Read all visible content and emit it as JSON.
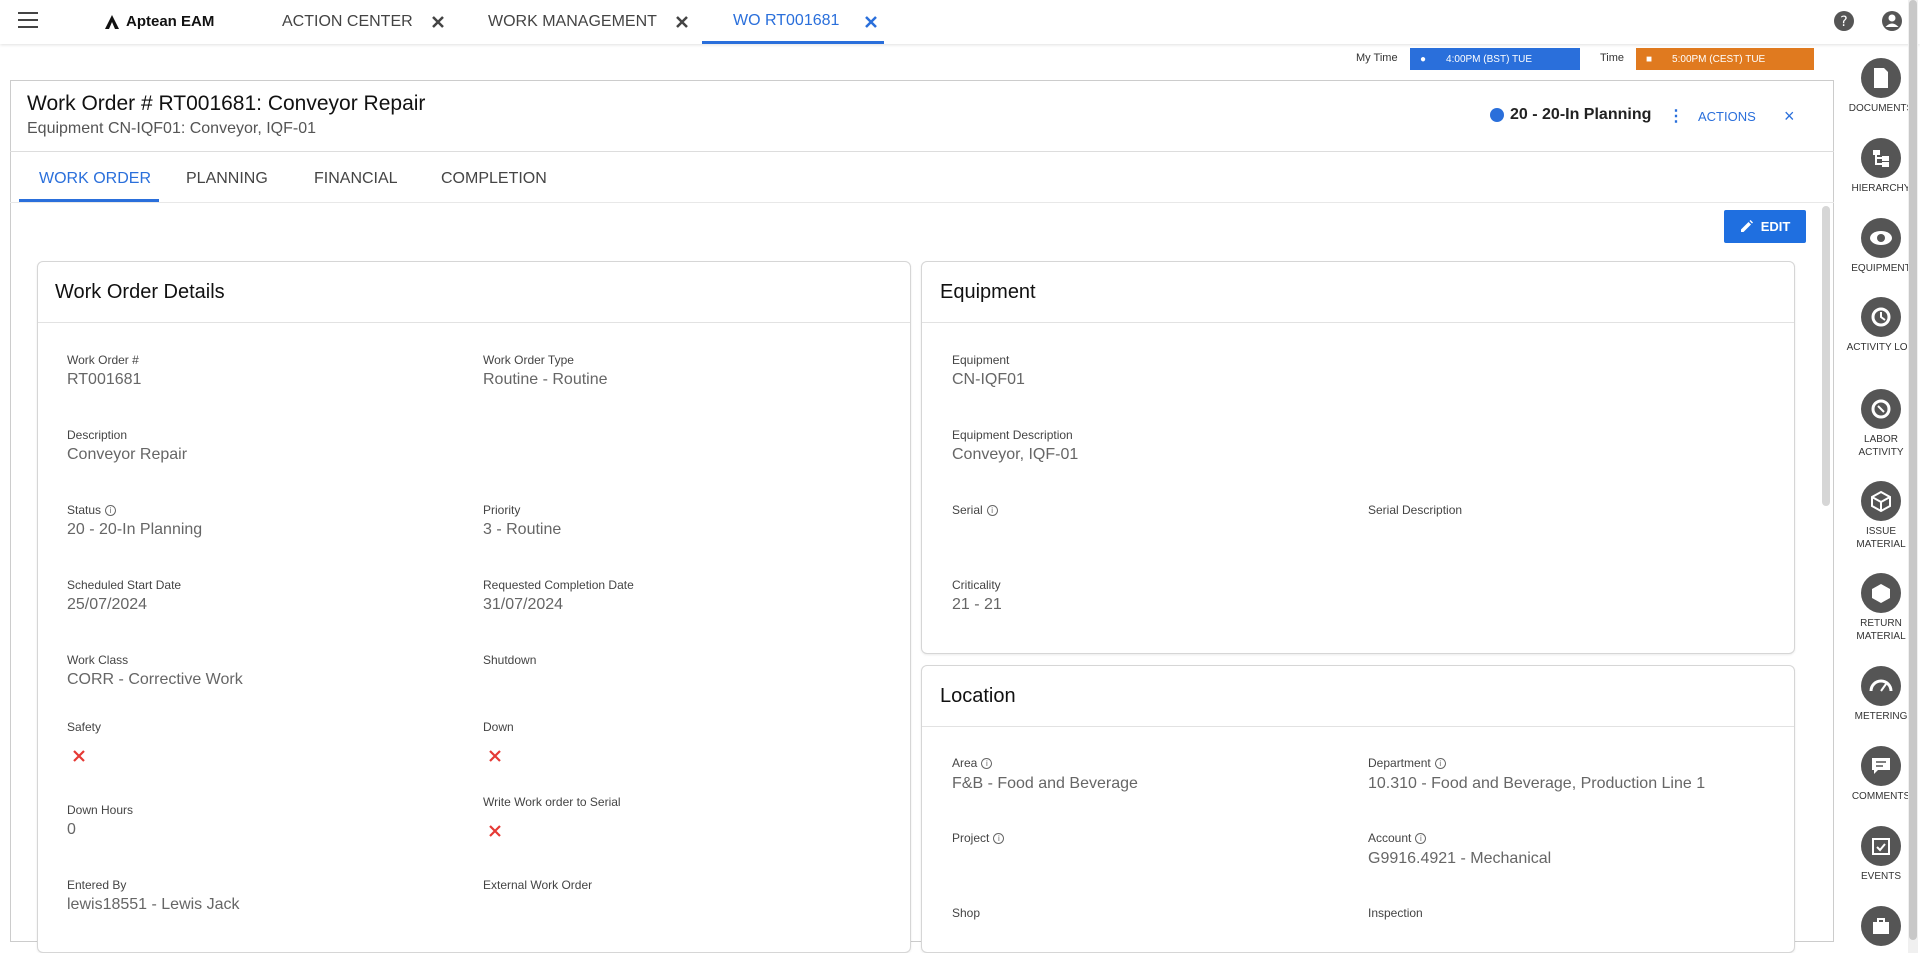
{
  "app": {
    "logo_text": "Aptean EAM"
  },
  "top_tabs": [
    {
      "label": "ACTION CENTER",
      "active": false
    },
    {
      "label": "WORK MANAGEMENT",
      "active": false
    },
    {
      "label": "WO RT001681",
      "active": true
    }
  ],
  "time": {
    "my_time_label": "My Time",
    "my_time_value": "4:00PM (BST) TUE",
    "time_label": "Time",
    "time_value": "5:00PM (CEST) TUE",
    "my_time_color": "#2a6fdb",
    "time_color": "#e07a1f"
  },
  "header": {
    "title": "Work Order # RT001681: Conveyor Repair",
    "subtitle": "Equipment CN-IQF01: Conveyor, IQF-01",
    "status": "20 - 20-In Planning",
    "actions_label": "ACTIONS",
    "close_label": "×"
  },
  "sub_tabs": [
    {
      "label": "WORK ORDER",
      "active": true
    },
    {
      "label": "PLANNING",
      "active": false
    },
    {
      "label": "FINANCIAL",
      "active": false
    },
    {
      "label": "COMPLETION",
      "active": false
    }
  ],
  "edit_label": "EDIT",
  "wo_details": {
    "title": "Work Order Details",
    "fields": {
      "wo_num_label": "Work Order #",
      "wo_num": "RT001681",
      "wo_type_label": "Work Order Type",
      "wo_type": "Routine - Routine",
      "desc_label": "Description",
      "desc": "Conveyor Repair",
      "status_label": "Status",
      "status": "20 - 20-In Planning",
      "priority_label": "Priority",
      "priority": "3 - Routine",
      "sched_label": "Scheduled Start Date",
      "sched": "25/07/2024",
      "req_label": "Requested Completion Date",
      "req": "31/07/2024",
      "class_label": "Work Class",
      "class": "CORR - Corrective Work",
      "shutdown_label": "Shutdown",
      "safety_label": "Safety",
      "down_label": "Down",
      "down_hours_label": "Down Hours",
      "down_hours": "0",
      "write_serial_label": "Write Work order to Serial",
      "entered_label": "Entered By",
      "entered": "lewis18551 - Lewis Jack",
      "ext_label": "External Work Order"
    }
  },
  "equipment": {
    "title": "Equipment",
    "fields": {
      "eq_label": "Equipment",
      "eq": "CN-IQF01",
      "eq_desc_label": "Equipment Description",
      "eq_desc": "Conveyor, IQF-01",
      "serial_label": "Serial",
      "serial_desc_label": "Serial Description",
      "crit_label": "Criticality",
      "crit": "21 - 21"
    }
  },
  "location": {
    "title": "Location",
    "fields": {
      "area_label": "Area",
      "area": "F&B - Food and Beverage",
      "dept_label": "Department",
      "dept": "10.310 - Food and Beverage, Production Line 1",
      "project_label": "Project",
      "account_label": "Account",
      "account": "G9916.4921 - Mechanical",
      "shop_label": "Shop",
      "inspection_label": "Inspection"
    }
  },
  "sidebar": [
    {
      "label": "DOCUMENTS",
      "icon": "document-icon"
    },
    {
      "label": "HIERARCHY",
      "icon": "hierarchy-icon"
    },
    {
      "label": "EQUIPMENT",
      "icon": "eye-icon"
    },
    {
      "label": "ACTIVITY LOG",
      "icon": "activity-log-icon"
    },
    {
      "label": "LABOR ACTIVITY",
      "icon": "labor-icon"
    },
    {
      "label": "ISSUE MATERIAL",
      "icon": "issue-material-icon"
    },
    {
      "label": "RETURN MATERIAL",
      "icon": "return-material-icon"
    },
    {
      "label": "METERING",
      "icon": "metering-icon"
    },
    {
      "label": "COMMENTS",
      "icon": "comments-icon"
    },
    {
      "label": "EVENTS",
      "icon": "events-icon"
    },
    {
      "label": "",
      "icon": "briefcase-icon"
    }
  ]
}
